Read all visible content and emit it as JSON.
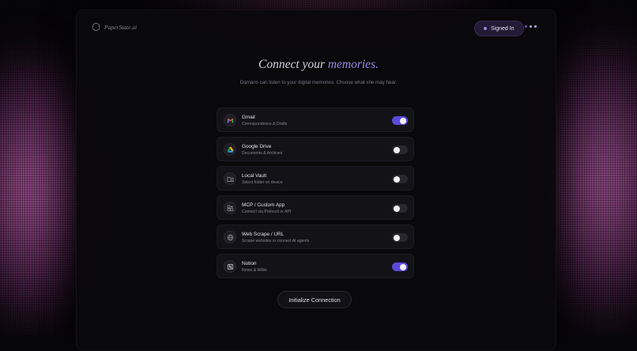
{
  "header": {
    "brand": "PaperState.ai",
    "signed_in": "Signed In",
    "more_icon": "ellipsis-icon"
  },
  "hero": {
    "title_prefix": "Connect your",
    "title_accent": "memories.",
    "subtitle": "Damaris can listen to your digital memories. Choose what she may hear."
  },
  "connections": [
    {
      "name": "Gmail",
      "desc": "Correspondence & Drafts",
      "icon": "gmail-icon",
      "enabled": true
    },
    {
      "name": "Google Drive",
      "desc": "Documents & Archives",
      "icon": "drive-icon",
      "enabled": false
    },
    {
      "name": "Local Vault",
      "desc": "Select folder on device",
      "icon": "folder-icon",
      "enabled": false
    },
    {
      "name": "MCP / Custom App",
      "desc": "Connect via Protocol or API",
      "icon": "app-grid-icon",
      "enabled": false
    },
    {
      "name": "Web Scrape / URL",
      "desc": "Scrape websites or connect AI agents",
      "icon": "globe-icon",
      "enabled": false
    },
    {
      "name": "Notion",
      "desc": "Notes & Wikis",
      "icon": "notion-icon",
      "enabled": true
    }
  ],
  "actions": {
    "init_label": "Initialize Connection"
  },
  "colors": {
    "accent": "#5b4ad9",
    "accent_text": "#9c89e3",
    "glow": "#d670c4"
  }
}
